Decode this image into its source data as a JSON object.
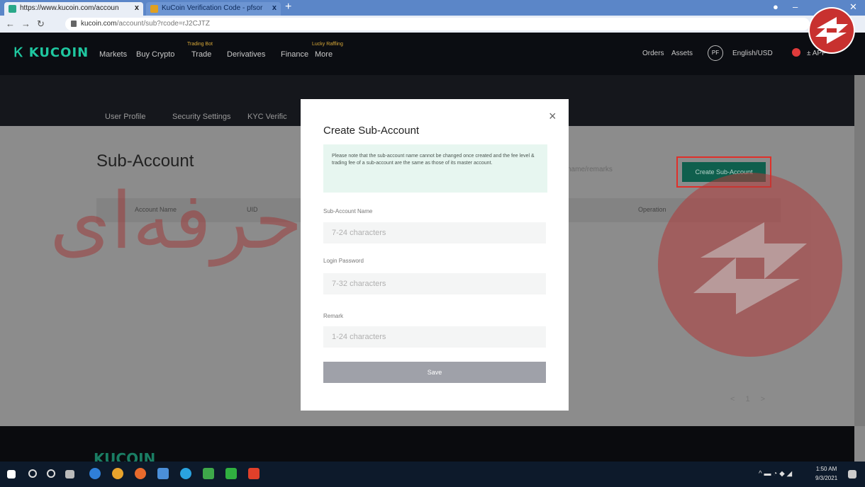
{
  "browser": {
    "tabs": [
      {
        "label": "https://www.kucoin.com/accoun",
        "close": "x"
      },
      {
        "label": "KuCoin Verification Code - pfsor",
        "close": "x"
      }
    ],
    "new_tab": "+",
    "url_host": "kucoin.com",
    "url_path": "/account/sub?rcode=rJ2CJTZ",
    "window_controls": {
      "minimize": "–",
      "close": "✕"
    }
  },
  "header": {
    "logo": "KUCOIN",
    "nav": [
      {
        "label": "Markets",
        "sup": ""
      },
      {
        "label": "Buy Crypto",
        "sup": ""
      },
      {
        "label": "Trade",
        "sup": "Trading Bot"
      },
      {
        "label": "Derivatives",
        "sup": ""
      },
      {
        "label": "Finance",
        "sup": ""
      },
      {
        "label": "More",
        "sup": "Lucky Raffling"
      }
    ],
    "right": {
      "orders": "Orders",
      "assets": "Assets",
      "avatar": "PF",
      "lang": "English/USD",
      "app": "± APP"
    }
  },
  "subnav": [
    "User Profile",
    "Security Settings",
    "KYC Verific"
  ],
  "page": {
    "title": "Sub-Account",
    "columns": {
      "account_name": "Account Name",
      "uid": "UID",
      "operation": "Operation"
    },
    "search_ghost": "name/remarks",
    "create_button": "Create Sub-Account",
    "pager": "< 1 >"
  },
  "watermark": {
    "text": "فارکس حرفه‌ای"
  },
  "footer": {
    "logo": "KUCOIN"
  },
  "modal": {
    "close": "×",
    "title": "Create Sub-Account",
    "notice": "Please note that the sub-account name cannot be changed once created and the fee level & trading fee of a sub-account are the same as those of its master account.",
    "fields": [
      {
        "label": "Sub-Account Name",
        "placeholder": "7-24 characters"
      },
      {
        "label": "Login Password",
        "placeholder": "7-32 characters"
      },
      {
        "label": "Remark",
        "placeholder": "1-24 characters"
      }
    ],
    "save": "Save"
  },
  "taskbar": {
    "time": "1:50 AM",
    "date": "9/3/2021"
  },
  "colors": {
    "accent": "#1fc7a0",
    "create_button": "#0f5f4d",
    "highlight": "#e0302a",
    "watermark": "#a22c2c"
  }
}
